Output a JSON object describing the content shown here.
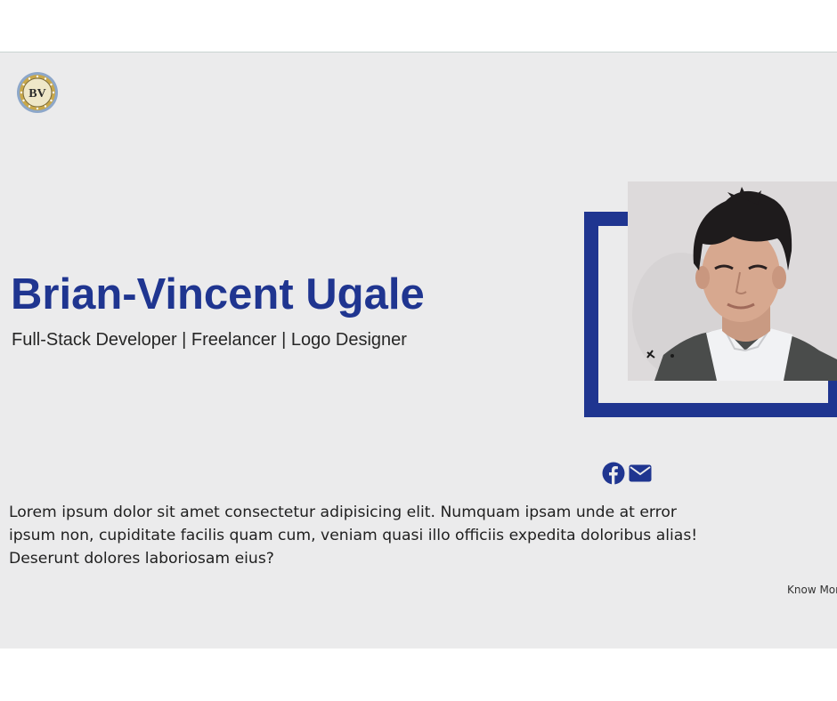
{
  "colors": {
    "accent": "#1f3590",
    "hero_background": "#ebebec",
    "page_background": "#ffffff",
    "text": "#262626"
  },
  "header": {
    "logo_text": "BV",
    "logo_icon": "bv-logo-icon"
  },
  "hero": {
    "name": "Brian-Vincent Ugale",
    "roles": "Full-Stack Developer | Freelancer | Logo Designer",
    "photo_icon": "profile-photo"
  },
  "social": {
    "facebook_icon": "facebook-icon",
    "email_icon": "envelope-icon"
  },
  "about": {
    "text": "Lorem ipsum dolor sit amet consectetur adipisicing elit. Numquam ipsam unde at error ipsum non, cupiditate facilis quam cum, veniam quasi illo officiis expedita doloribus alias! Deserunt dolores laboriosam eius?",
    "more_link": "Know More"
  }
}
